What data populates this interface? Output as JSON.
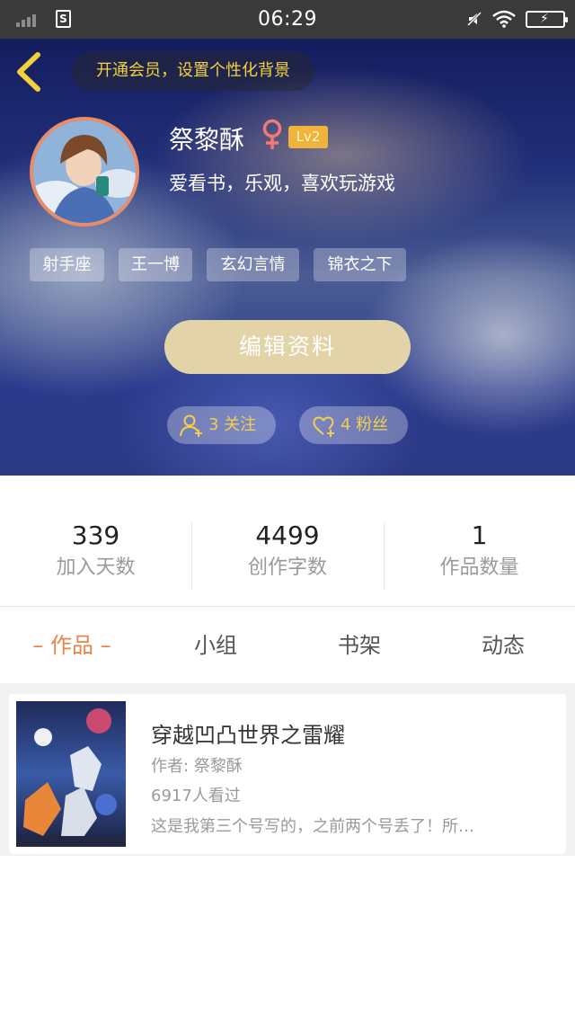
{
  "status_bar": {
    "time": "06:29",
    "sim_label": "S"
  },
  "header": {
    "vip_prompt": "开通会员，设置个性化背景",
    "username": "祭黎酥",
    "level": "Lv2",
    "bio": "爱看书，乐观，喜欢玩游戏",
    "tags": [
      "射手座",
      "王一博",
      "玄幻言情",
      "锦衣之下"
    ],
    "edit_button": "编辑资料",
    "following_label": "3 关注",
    "followers_label": "4 粉丝"
  },
  "stats": [
    {
      "value": "339",
      "label": "加入天数"
    },
    {
      "value": "4499",
      "label": "创作字数"
    },
    {
      "value": "1",
      "label": "作品数量"
    }
  ],
  "tabs": [
    {
      "label": "– 作品 –",
      "active": true
    },
    {
      "label": "小组",
      "active": false
    },
    {
      "label": "书架",
      "active": false
    },
    {
      "label": "动态",
      "active": false
    }
  ],
  "books": [
    {
      "title": "穿越凹凸世界之雷耀",
      "author": "作者: 祭黎酥",
      "views": "6917人看过",
      "description": "这是我第三个号写的，之前两个号丢了！所…"
    }
  ],
  "colors": {
    "accent": "#e8844a",
    "vip_text": "#f4d13e",
    "level_badge": "#f0b43a",
    "edit_button": "#e3d3a8"
  }
}
